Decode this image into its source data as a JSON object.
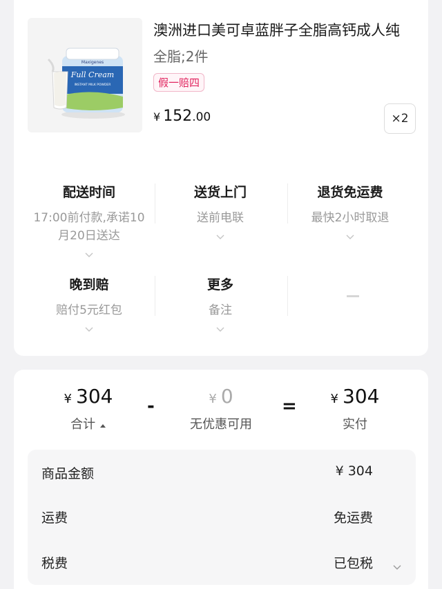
{
  "product": {
    "title": "澳洲进口美可卓蓝胖子全脂高钙成人纯",
    "spec": "全脂;2件",
    "badge": "假一赔四",
    "price_symbol": "¥",
    "price_int": "152",
    "price_dec": ".00",
    "quantity": "×2",
    "image_brand": "Maxigenes",
    "image_name": "Full Cream",
    "image_sub": "INSTANT MILK POWDER"
  },
  "services": [
    {
      "title": "配送时间",
      "desc": "17:00前付款,承诺10月20日送达"
    },
    {
      "title": "送货上门",
      "desc": "送前电联"
    },
    {
      "title": "退货免运费",
      "desc": "最快2小时取退"
    },
    {
      "title": "晚到赔",
      "desc": "赔付5元红包"
    },
    {
      "title": "更多",
      "desc": "备注"
    }
  ],
  "summary": {
    "currency": "¥",
    "total_value": "304",
    "total_label": "合计",
    "discount_value": "0",
    "discount_label": "无优惠可用",
    "minus": "-",
    "equals": "=",
    "pay_value": "304",
    "pay_label": "实付"
  },
  "details": [
    {
      "label": "商品金额",
      "value": "¥ 304"
    },
    {
      "label": "运费",
      "value": "免运费"
    },
    {
      "label": "税费",
      "value": "已包税"
    }
  ],
  "colors": {
    "accent": "#e0245e",
    "muted": "#999999"
  }
}
